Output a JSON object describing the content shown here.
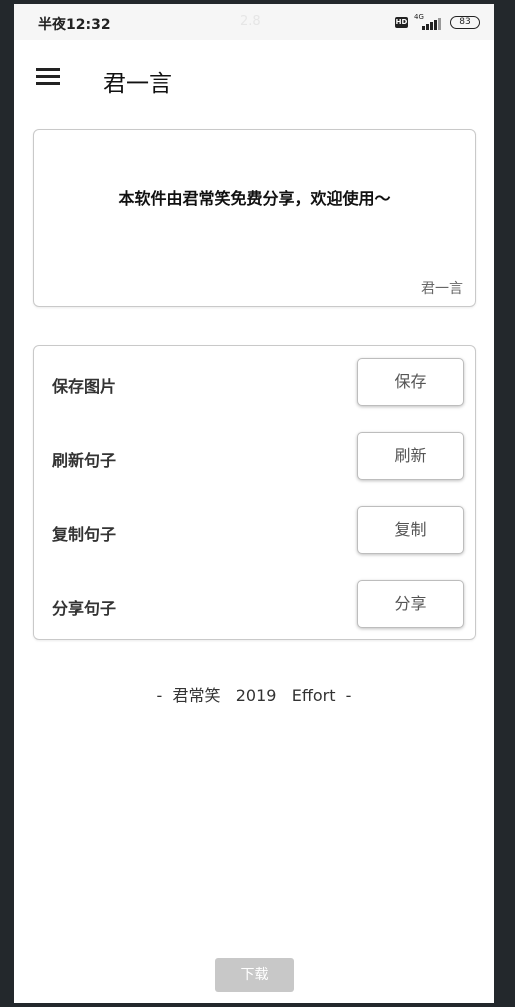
{
  "status_bar": {
    "time": "半夜12:32",
    "center_text": "2.8",
    "hd_badge": "HD",
    "network_label": "4G",
    "battery": "83"
  },
  "app_bar": {
    "title": "君一言",
    "menu_icon": "hamburger-menu-icon"
  },
  "quote": {
    "text": "本软件由君常笑免费分享，欢迎使用～",
    "author": "君一言"
  },
  "actions": [
    {
      "label": "保存图片",
      "button": "保存"
    },
    {
      "label": "刷新句子",
      "button": "刷新"
    },
    {
      "label": "复制句子",
      "button": "复制"
    },
    {
      "label": "分享句子",
      "button": "分享"
    }
  ],
  "footer": {
    "text": "-  君常笑   2019   Effort  -"
  },
  "download": {
    "label": "下载"
  }
}
